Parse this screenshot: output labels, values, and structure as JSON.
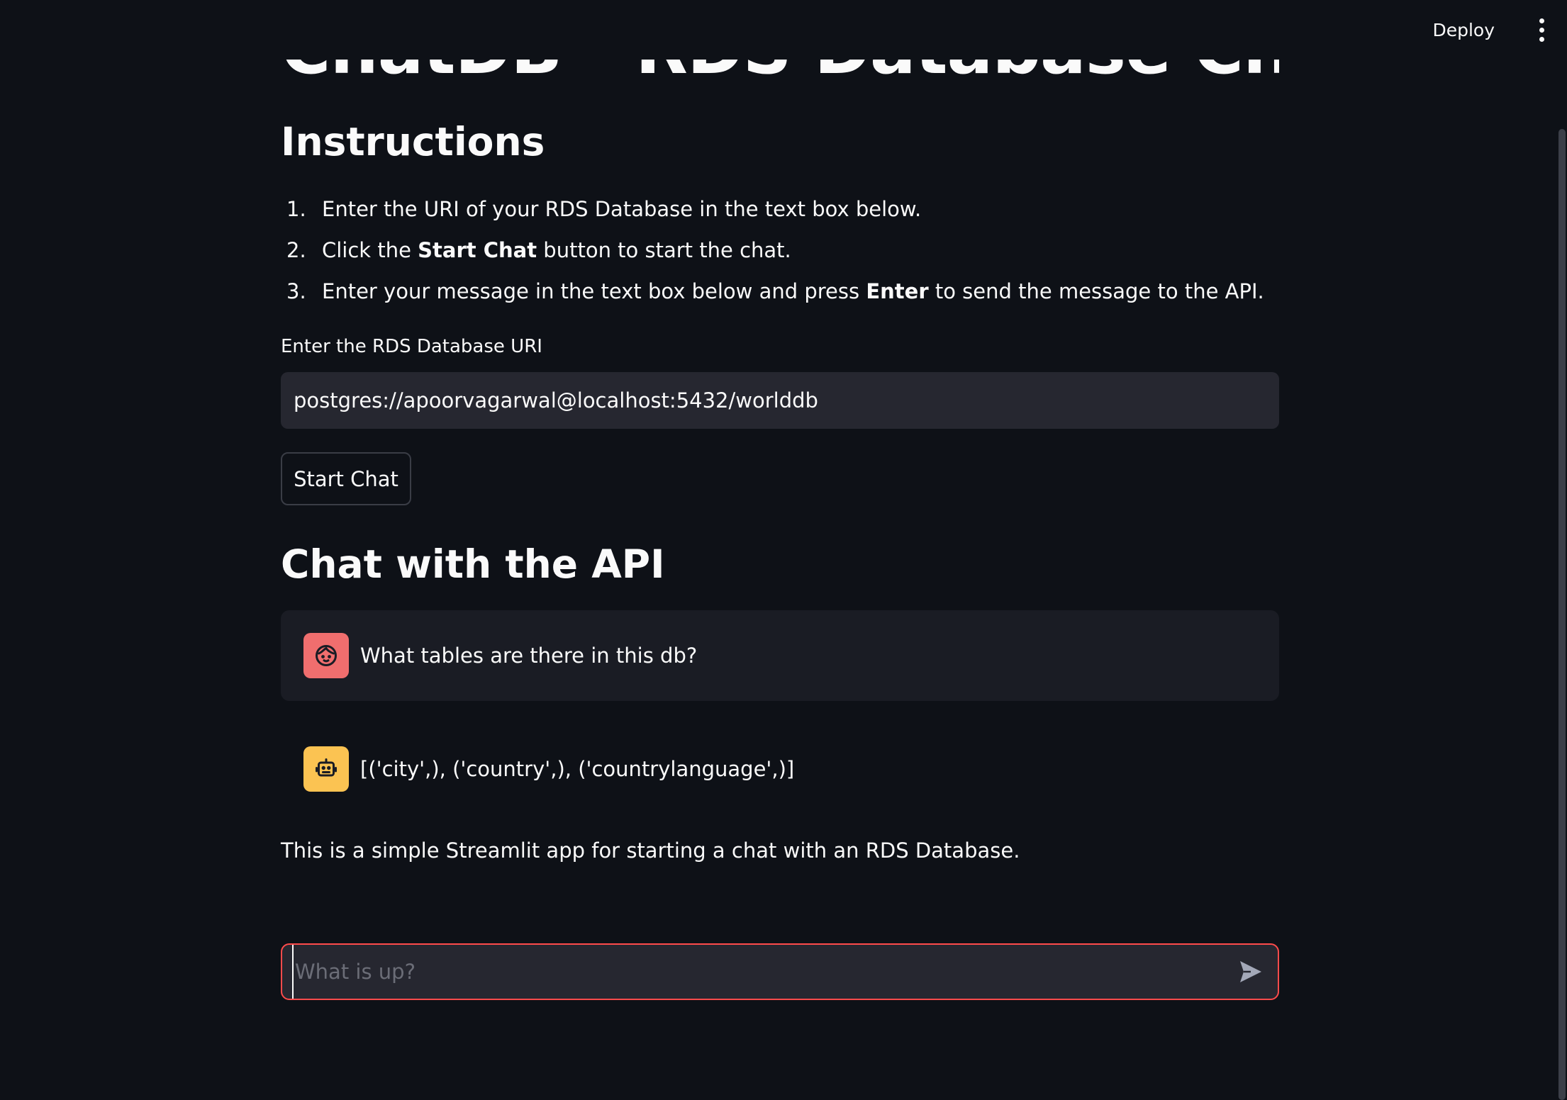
{
  "header": {
    "deploy_label": "Deploy"
  },
  "page": {
    "title": "ChatDB - RDS Database Chat App",
    "instructions_heading": "Instructions",
    "steps": [
      {
        "num": "1.",
        "pre": "Enter the URI of your RDS Database in the text box below.",
        "bold": "",
        "post": "",
        "bold2": "",
        "post2": ""
      },
      {
        "num": "2.",
        "pre": "Click the ",
        "bold": "Start Chat",
        "post": " button to start the chat.",
        "bold2": "",
        "post2": ""
      },
      {
        "num": "3.",
        "pre": "Enter your message in the text box below and press ",
        "bold": "Enter",
        "post": " to send the message to the API.",
        "bold2": "",
        "post2": ""
      }
    ],
    "uri_label": "Enter the RDS Database URI",
    "uri_value": "postgres://apoorvagarwal@localhost:5432/worlddb",
    "start_button": "Start Chat",
    "chat_heading": "Chat with the API",
    "messages": [
      {
        "role": "user",
        "text": "What tables are there in this db?"
      },
      {
        "role": "assistant",
        "text": "[('city',), ('country',), ('countrylanguage',)]"
      }
    ],
    "footer_text": "This is a simple Streamlit app for starting a chat with an RDS Database.",
    "chat_input_placeholder": "What is up?"
  },
  "colors": {
    "background": "#0e1117",
    "input_bg": "#262730",
    "accent": "#ff4b4b",
    "user_avatar": "#f06e6e",
    "bot_avatar": "#fbc352"
  },
  "icons": {
    "menu": "kebab-menu-icon",
    "user_avatar": "user-face-icon",
    "bot_avatar": "robot-icon",
    "send": "send-arrow-icon"
  }
}
